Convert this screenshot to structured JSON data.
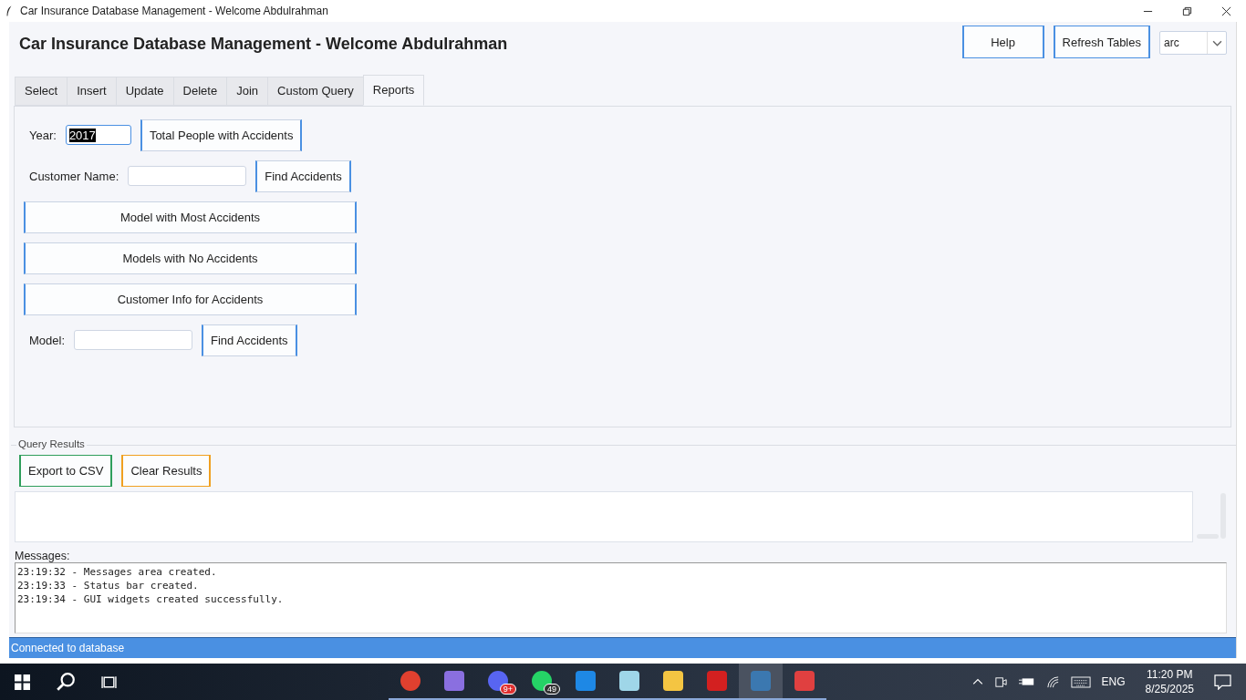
{
  "window": {
    "title": "Car Insurance Database Management - Welcome Abdulrahman"
  },
  "header": {
    "heading": "Car Insurance Database Management - Welcome Abdulrahman",
    "buttons": [
      "Help",
      "Refresh Tables"
    ],
    "theme_select": {
      "value": "arc"
    }
  },
  "tabs": [
    {
      "label": "Select",
      "selected": false
    },
    {
      "label": "Insert",
      "selected": false
    },
    {
      "label": "Update",
      "selected": false
    },
    {
      "label": "Delete",
      "selected": false
    },
    {
      "label": "Join",
      "selected": false
    },
    {
      "label": "Custom Query",
      "selected": false
    },
    {
      "label": "Reports",
      "selected": true
    }
  ],
  "reports": [
    {
      "kind": "field",
      "label": "Year:",
      "value": "2017",
      "value_selected": true,
      "button": "Total People with Accidents"
    },
    {
      "kind": "field",
      "label": "Customer Name:",
      "value_selected": false,
      "button": "Find Accidents"
    },
    {
      "kind": "wide",
      "button": "Model with Most Accidents"
    },
    {
      "kind": "wide",
      "button": "Models with No Accidents"
    },
    {
      "kind": "wide",
      "button": "Customer Info for Accidents"
    },
    {
      "kind": "field",
      "label": "Model:",
      "value_selected": false,
      "button": "Find Accidents"
    }
  ],
  "query_results": {
    "title": "Query Results",
    "buttons": [
      {
        "label": "Export to CSV",
        "color": "#2e9e5b"
      },
      {
        "label": "Clear Results",
        "color": "#f0a020"
      }
    ]
  },
  "messages": {
    "label": "Messages:",
    "lines": [
      "23:19:32 - Messages area created.",
      "23:19:33 - Status bar created.",
      "23:19:34 - GUI widgets created successfully."
    ]
  },
  "status_bar": "Connected to database",
  "taskbar": {
    "apps": [
      {
        "kind": "chrome",
        "selected": false
      },
      {
        "kind": "crystal",
        "selected": false
      },
      {
        "kind": "discord",
        "selected": false,
        "badge": "9+"
      },
      {
        "kind": "whatsapp",
        "selected": false,
        "badge": "49"
      },
      {
        "kind": "vscode",
        "selected": false
      },
      {
        "kind": "notepad",
        "selected": false
      },
      {
        "kind": "folder",
        "selected": false
      },
      {
        "kind": "pdf",
        "selected": false
      },
      {
        "kind": "python",
        "selected": true
      },
      {
        "kind": "scissors",
        "selected": false
      }
    ],
    "language": "ENG",
    "time": "11:20 PM",
    "date": "8/25/2025"
  }
}
